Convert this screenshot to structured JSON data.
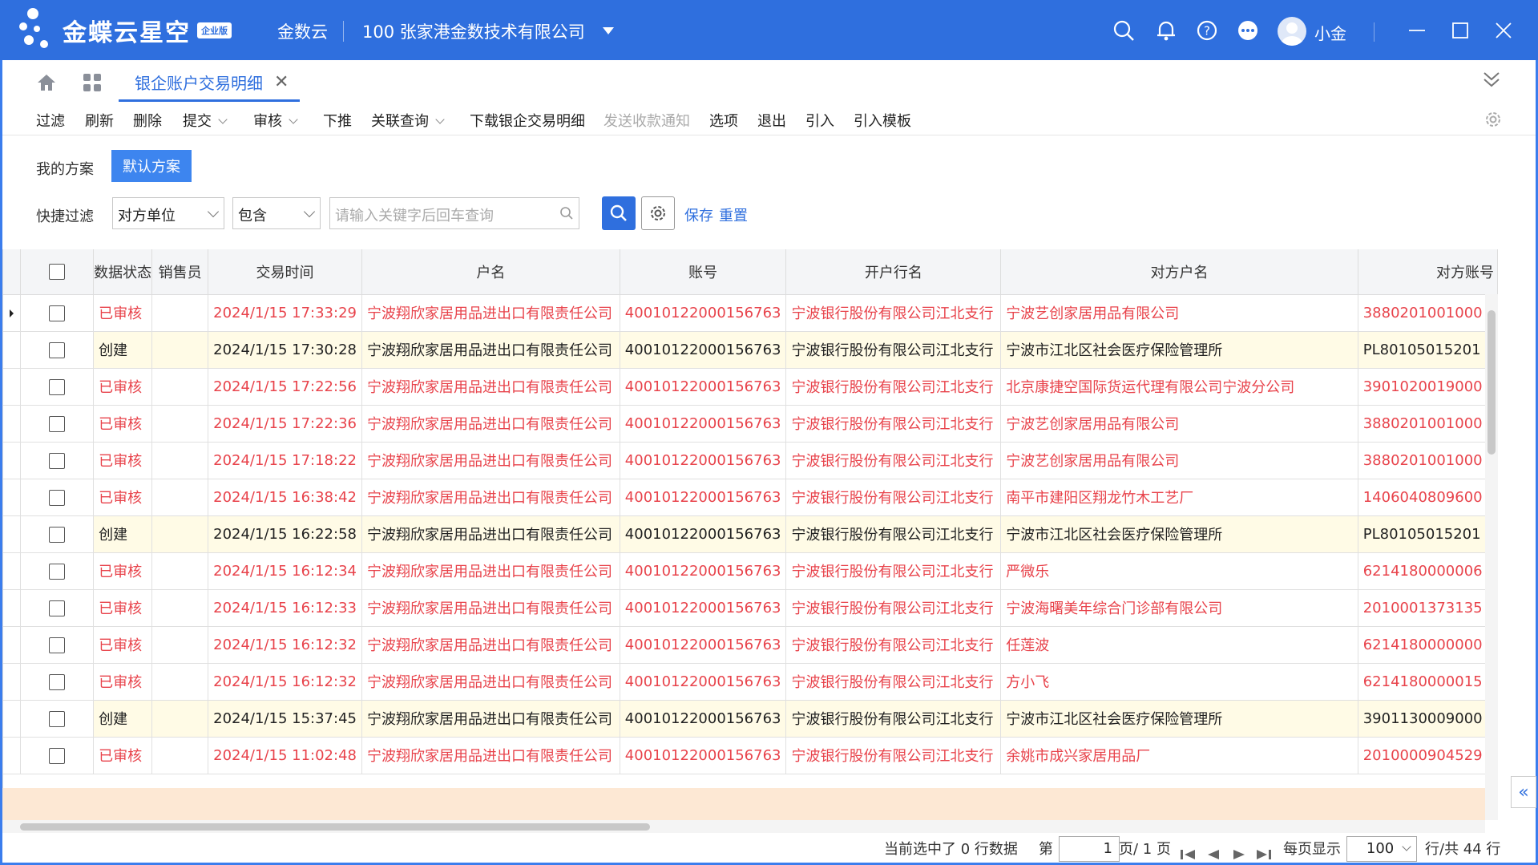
{
  "header": {
    "logo_text": "金蝶云星空",
    "logo_badge": "企业版",
    "app_name": "金数云",
    "org": "100  张家港金数技术有限公司",
    "username": "小金"
  },
  "tabs": {
    "active": "银企账户交易明细"
  },
  "toolbar": {
    "filter": "过滤",
    "refresh": "刷新",
    "delete": "删除",
    "submit": "提交",
    "audit": "审核",
    "push_down": "下推",
    "related_query": "关联查询",
    "download_detail": "下载银企交易明细",
    "send_notice": "发送收款通知",
    "options": "选项",
    "exit": "退出",
    "import": "引入",
    "import_template": "引入模板"
  },
  "scheme": {
    "label": "我的方案",
    "default": "默认方案"
  },
  "quick_filter": {
    "label": "快捷过滤",
    "field": "对方单位",
    "operator": "包含",
    "placeholder": "请输入关键字后回车查询",
    "save": "保存",
    "reset": "重置"
  },
  "grid": {
    "columns": [
      "数据状态",
      "销售员",
      "交易时间",
      "户名",
      "账号",
      "开户行名",
      "对方户名",
      "对方账号"
    ],
    "rows": [
      {
        "status": "已审核",
        "kind": "aud",
        "sales": "",
        "time": "2024/1/15 17:33:29",
        "name": "宁波翔欣家居用品进出口有限责任公司",
        "acct": "40010122000156763",
        "bank": "宁波银行股份有限公司江北支行",
        "other": "宁波艺创家居用品有限公司",
        "other_acct": "3880201001000"
      },
      {
        "status": "创建",
        "kind": "cre",
        "sales": "",
        "time": "2024/1/15 17:30:28",
        "name": "宁波翔欣家居用品进出口有限责任公司",
        "acct": "40010122000156763",
        "bank": "宁波银行股份有限公司江北支行",
        "other": "宁波市江北区社会医疗保险管理所",
        "other_acct": "PL80105015201"
      },
      {
        "status": "已审核",
        "kind": "aud",
        "sales": "",
        "time": "2024/1/15 17:22:56",
        "name": "宁波翔欣家居用品进出口有限责任公司",
        "acct": "40010122000156763",
        "bank": "宁波银行股份有限公司江北支行",
        "other": "北京康捷空国际货运代理有限公司宁波分公司",
        "other_acct": "3901020019000"
      },
      {
        "status": "已审核",
        "kind": "aud",
        "sales": "",
        "time": "2024/1/15 17:22:36",
        "name": "宁波翔欣家居用品进出口有限责任公司",
        "acct": "40010122000156763",
        "bank": "宁波银行股份有限公司江北支行",
        "other": "宁波艺创家居用品有限公司",
        "other_acct": "3880201001000"
      },
      {
        "status": "已审核",
        "kind": "aud",
        "sales": "",
        "time": "2024/1/15 17:18:22",
        "name": "宁波翔欣家居用品进出口有限责任公司",
        "acct": "40010122000156763",
        "bank": "宁波银行股份有限公司江北支行",
        "other": "宁波艺创家居用品有限公司",
        "other_acct": "3880201001000"
      },
      {
        "status": "已审核",
        "kind": "aud",
        "sales": "",
        "time": "2024/1/15 16:38:42",
        "name": "宁波翔欣家居用品进出口有限责任公司",
        "acct": "40010122000156763",
        "bank": "宁波银行股份有限公司江北支行",
        "other": "南平市建阳区翔龙竹木工艺厂",
        "other_acct": "1406040809600"
      },
      {
        "status": "创建",
        "kind": "cre",
        "sales": "",
        "time": "2024/1/15 16:22:58",
        "name": "宁波翔欣家居用品进出口有限责任公司",
        "acct": "40010122000156763",
        "bank": "宁波银行股份有限公司江北支行",
        "other": "宁波市江北区社会医疗保险管理所",
        "other_acct": "PL80105015201"
      },
      {
        "status": "已审核",
        "kind": "aud",
        "sales": "",
        "time": "2024/1/15 16:12:34",
        "name": "宁波翔欣家居用品进出口有限责任公司",
        "acct": "40010122000156763",
        "bank": "宁波银行股份有限公司江北支行",
        "other": "严微乐",
        "other_acct": "6214180000006"
      },
      {
        "status": "已审核",
        "kind": "aud",
        "sales": "",
        "time": "2024/1/15 16:12:33",
        "name": "宁波翔欣家居用品进出口有限责任公司",
        "acct": "40010122000156763",
        "bank": "宁波银行股份有限公司江北支行",
        "other": "宁波海曙美年综合门诊部有限公司",
        "other_acct": "2010001373135"
      },
      {
        "status": "已审核",
        "kind": "aud",
        "sales": "",
        "time": "2024/1/15 16:12:32",
        "name": "宁波翔欣家居用品进出口有限责任公司",
        "acct": "40010122000156763",
        "bank": "宁波银行股份有限公司江北支行",
        "other": "任莲波",
        "other_acct": "6214180000000"
      },
      {
        "status": "已审核",
        "kind": "aud",
        "sales": "",
        "time": "2024/1/15 16:12:32",
        "name": "宁波翔欣家居用品进出口有限责任公司",
        "acct": "40010122000156763",
        "bank": "宁波银行股份有限公司江北支行",
        "other": "方小飞",
        "other_acct": "6214180000015"
      },
      {
        "status": "创建",
        "kind": "cre",
        "sales": "",
        "time": "2024/1/15 15:37:45",
        "name": "宁波翔欣家居用品进出口有限责任公司",
        "acct": "40010122000156763",
        "bank": "宁波银行股份有限公司江北支行",
        "other": "宁波市江北区社会医疗保险管理所",
        "other_acct": "3901130009000"
      },
      {
        "status": "已审核",
        "kind": "aud",
        "sales": "",
        "time": "2024/1/15 11:02:48",
        "name": "宁波翔欣家居用品进出口有限责任公司",
        "acct": "40010122000156763",
        "bank": "宁波银行股份有限公司江北支行",
        "other": "余姚市成兴家居用品厂",
        "other_acct": "2010000904529"
      }
    ]
  },
  "pager": {
    "selected": "当前选中了 0 行数据",
    "page_prefix": "第",
    "page": "1",
    "page_suffix": "页/ 1 页",
    "per_page_label": "每页显示",
    "per_page": "100",
    "total": "行/共 44 行"
  },
  "colors": {
    "brand": "#2f6fde",
    "audited_text": "#e8434b",
    "created_row_bg": "#fffbe6"
  }
}
